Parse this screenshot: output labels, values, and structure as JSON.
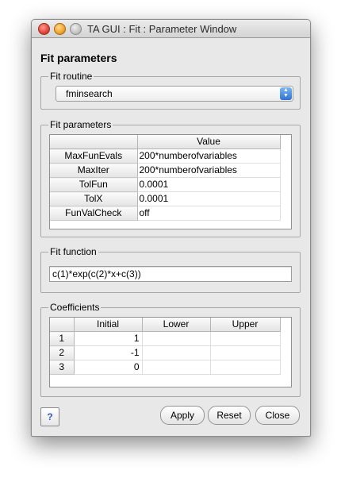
{
  "window": {
    "title": "TA GUI : Fit : Parameter Window"
  },
  "heading": "Fit parameters",
  "routine": {
    "legend": "Fit routine",
    "selected": "fminsearch"
  },
  "params": {
    "legend": "Fit parameters",
    "value_header": "Value",
    "rows": [
      {
        "name": "MaxFunEvals",
        "value": "200*numberofvariables"
      },
      {
        "name": "MaxIter",
        "value": "200*numberofvariables"
      },
      {
        "name": "TolFun",
        "value": "0.0001"
      },
      {
        "name": "TolX",
        "value": "0.0001"
      },
      {
        "name": "FunValCheck",
        "value": "off"
      }
    ]
  },
  "function": {
    "legend": "Fit function",
    "value": "c(1)*exp(c(2)*x+c(3))"
  },
  "coefficients": {
    "legend": "Coefficients",
    "headers": [
      "Initial",
      "Lower",
      "Upper"
    ],
    "rows": [
      {
        "index": "1",
        "initial": "1",
        "lower": "",
        "upper": ""
      },
      {
        "index": "2",
        "initial": "-1",
        "lower": "",
        "upper": ""
      },
      {
        "index": "3",
        "initial": "0",
        "lower": "",
        "upper": ""
      }
    ]
  },
  "buttons": {
    "help": "?",
    "apply": "Apply",
    "reset": "Reset",
    "close": "Close"
  }
}
